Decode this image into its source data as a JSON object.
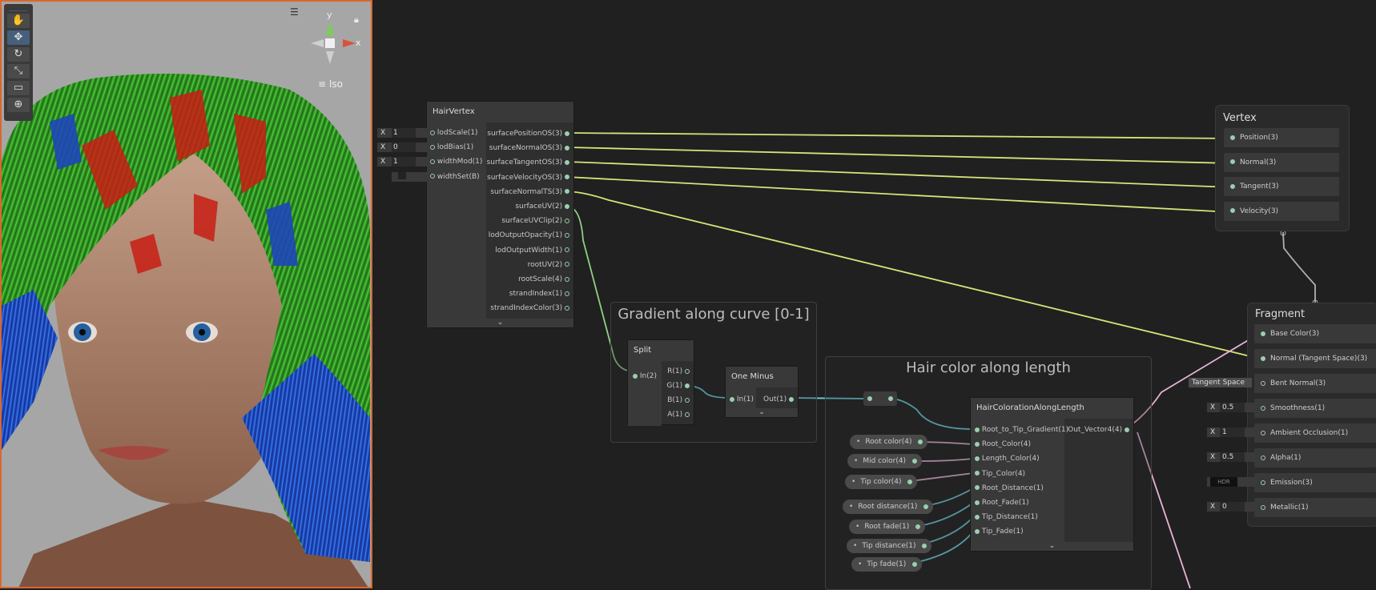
{
  "viewport": {
    "axis_y": "y",
    "axis_x": "x",
    "view_label": "Iso",
    "tools": [
      "hand-tool-icon",
      "move-tool-icon",
      "rotate-tool-icon",
      "scale-tool-icon",
      "rect-tool-icon",
      "transform-tool-icon"
    ]
  },
  "hair_vertex": {
    "title": "HairVertex",
    "inputs": [
      {
        "axis": "X",
        "value": "1",
        "label": "lodScale(1)"
      },
      {
        "axis": "X",
        "value": "0",
        "label": "lodBias(1)"
      },
      {
        "axis": "X",
        "value": "1",
        "label": "widthMod(1)"
      },
      {
        "axis": "",
        "value": "",
        "label": "widthSet(B)"
      }
    ],
    "outputs": [
      "surfacePositionOS(3)",
      "surfaceNormalOS(3)",
      "surfaceTangentOS(3)",
      "surfaceVelocityOS(3)",
      "surfaceNormalTS(3)",
      "surfaceUV(2)",
      "surfaceUVClip(2)",
      "lodOutputOpacity(1)",
      "lodOutputWidth(1)",
      "rootUV(2)",
      "rootScale(4)",
      "strandIndex(1)",
      "strandIndexColor(3)"
    ]
  },
  "vertex": {
    "title": "Vertex",
    "slots": [
      "Position(3)",
      "Normal(3)",
      "Tangent(3)",
      "Velocity(3)"
    ]
  },
  "fragment": {
    "title": "Fragment",
    "slots": [
      {
        "label": "Base Color(3)",
        "input": ""
      },
      {
        "label": "Normal (Tangent Space)(3)",
        "input": ""
      },
      {
        "label": "Bent Normal(3)",
        "input": "Tangent Space"
      },
      {
        "label": "Smoothness(1)",
        "input": "0.5",
        "axis": "X"
      },
      {
        "label": "Ambient Occlusion(1)",
        "input": "1",
        "axis": "X"
      },
      {
        "label": "Alpha(1)",
        "input": "0.5",
        "axis": "X"
      },
      {
        "label": "Emission(3)",
        "input": "HDR"
      },
      {
        "label": "Metallic(1)",
        "input": "0",
        "axis": "X"
      }
    ]
  },
  "group_gradient": {
    "title": "Gradient along curve [0-1]"
  },
  "group_color": {
    "title": "Hair color along length"
  },
  "split": {
    "title": "Split",
    "input": "In(2)",
    "outputs": [
      "R(1)",
      "G(1)",
      "B(1)",
      "A(1)"
    ]
  },
  "one_minus": {
    "title": "One Minus",
    "input": "In(1)",
    "output": "Out(1)"
  },
  "coloration": {
    "title": "HairColorationAlongLength",
    "inputs": [
      "Root_to_Tip_Gradient(1)",
      "Root_Color(4)",
      "Length_Color(4)",
      "Tip_Color(4)",
      "Root_Distance(1)",
      "Root_Fade(1)",
      "Tip_Distance(1)",
      "Tip_Fade(1)"
    ],
    "output": "Out_Vector4(4)"
  },
  "properties": [
    "Root color(4)",
    "Mid color(4)",
    "Tip color(4)",
    "Root distance(1)",
    "Root fade(1)",
    "Tip distance(1)",
    "Tip fade(1)"
  ],
  "colors": {
    "wire_yellow": "#d9e27a",
    "wire_green": "#8fd184",
    "wire_cyan": "#6ccfe0",
    "wire_pink": "#e8b4d8",
    "wire_grey": "#b0b0b0"
  }
}
